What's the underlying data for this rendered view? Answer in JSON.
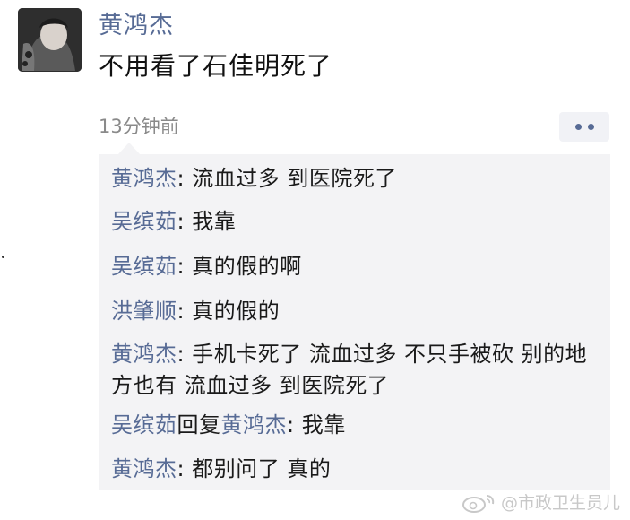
{
  "post": {
    "username": "黄鸿杰",
    "text": "不用看了石佳明死了",
    "time": "13分钟前"
  },
  "comments": [
    {
      "author": "黄鸿杰",
      "sep": ": ",
      "text": "流血过多 到医院死了"
    },
    {
      "author": "吴缤茹",
      "sep": ": ",
      "text": "我靠"
    },
    {
      "author": "吴缤茹",
      "sep": ": ",
      "text": "真的假的啊"
    },
    {
      "author": "洪肇顺",
      "sep": ": ",
      "text": "真的假的"
    },
    {
      "author": "黄鸿杰",
      "sep": ": ",
      "text": "手机卡死了 流血过多 不只手被砍 别的地方也有 流血过多 到医院死了"
    },
    {
      "author": "吴缤茹",
      "reply_word": "回复",
      "reply_to": "黄鸿杰",
      "sep": ": ",
      "text": "我靠"
    },
    {
      "author": "黄鸿杰",
      "sep": ": ",
      "text": "都别问了 真的"
    }
  ],
  "watermark": {
    "text": "@市政卫生员儿",
    "icon": "weibo-icon"
  },
  "colors": {
    "name": "#576b95",
    "comment_bg": "#f3f3f5",
    "time": "#8a8a8a"
  }
}
